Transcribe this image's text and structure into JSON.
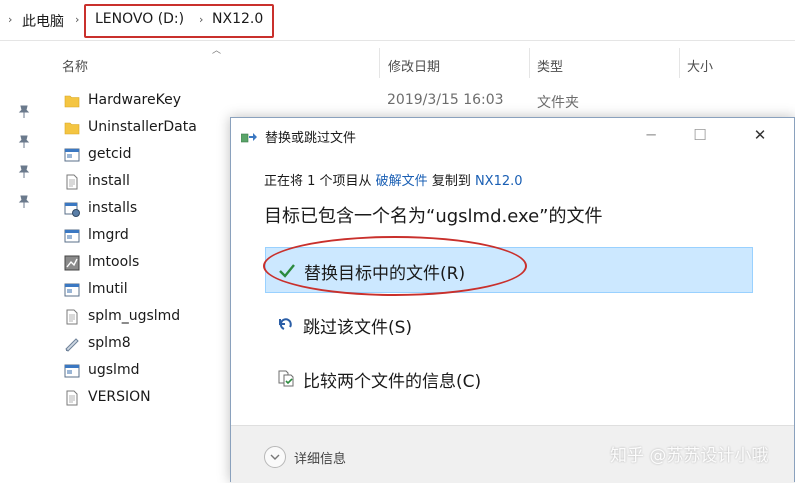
{
  "addressbar": {
    "segments": [
      "此电脑",
      "LENOVO (D:)",
      "NX12.0"
    ],
    "separator": "›"
  },
  "columns": {
    "name": "名称",
    "date": "修改日期",
    "type": "类型",
    "size": "大小"
  },
  "files": [
    {
      "name": "HardwareKey",
      "icon": "folder-icon",
      "date": "2019/3/15 16:03",
      "type": "文件夹"
    },
    {
      "name": "UninstallerData",
      "icon": "folder-icon",
      "date": "",
      "type": ""
    },
    {
      "name": "getcid",
      "icon": "exe-icon",
      "date": "",
      "type": ""
    },
    {
      "name": "install",
      "icon": "text-file-icon",
      "date": "",
      "type": ""
    },
    {
      "name": "installs",
      "icon": "installer-icon",
      "date": "",
      "type": ""
    },
    {
      "name": "lmgrd",
      "icon": "exe-icon",
      "date": "",
      "type": ""
    },
    {
      "name": "lmtools",
      "icon": "lmtools-icon",
      "date": "",
      "type": ""
    },
    {
      "name": "lmutil",
      "icon": "exe-icon",
      "date": "",
      "type": ""
    },
    {
      "name": "splm_ugslmd",
      "icon": "text-file-icon",
      "date": "",
      "type": ""
    },
    {
      "name": "splm8",
      "icon": "license-file-icon",
      "date": "",
      "type": ""
    },
    {
      "name": "ugslmd",
      "icon": "exe-icon",
      "date": "",
      "type": ""
    },
    {
      "name": "VERSION",
      "icon": "text-file-icon",
      "date": "",
      "type": ""
    }
  ],
  "dialog": {
    "title": "替换或跳过文件",
    "info_prefix": "正在将 1 个项目从 ",
    "info_source": "破解文件",
    "info_middle": " 复制到 ",
    "info_dest": "NX12.0",
    "heading": "目标已包含一个名为“ugslmd.exe”的文件",
    "options": [
      {
        "label": "替换目标中的文件(R)",
        "icon": "checkmark-icon"
      },
      {
        "label": "跳过该文件(S)",
        "icon": "skip-arrow-icon"
      },
      {
        "label": "比较两个文件的信息(C)",
        "icon": "compare-files-icon"
      }
    ],
    "details_label": "详细信息"
  },
  "watermark": "知乎 @苏苏设计小哦",
  "colors": {
    "highlight_red": "#c9302c",
    "selected_bg": "#cce8ff",
    "link_blue": "#1a5fb4"
  }
}
